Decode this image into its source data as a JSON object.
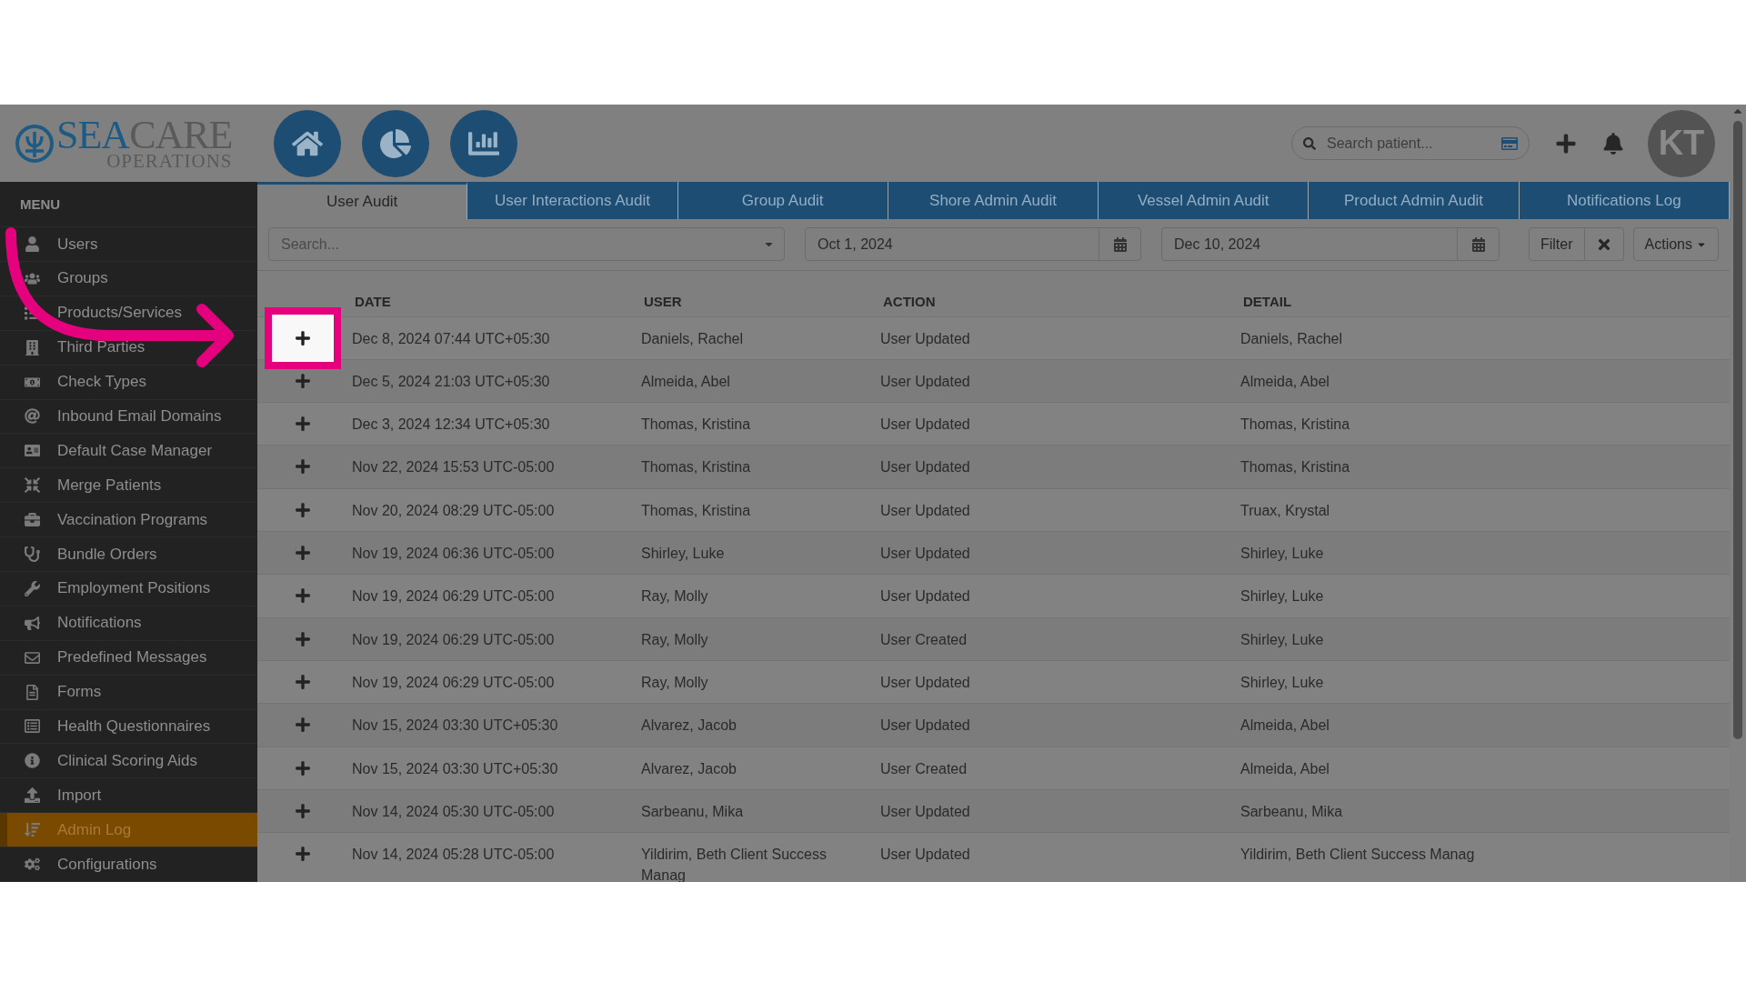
{
  "header": {
    "logo": {
      "brand_a": "SEA",
      "brand_b": "CARE",
      "subtitle": "OPERATIONS"
    },
    "search": {
      "placeholder": "Search patient..."
    },
    "avatar": "KT"
  },
  "sidebar": {
    "title": "MENU",
    "items": [
      {
        "label": "Users",
        "selected": false
      },
      {
        "label": "Groups",
        "selected": false
      },
      {
        "label": "Products/Services",
        "selected": false
      },
      {
        "label": "Third Parties",
        "selected": false
      },
      {
        "label": "Check Types",
        "selected": false
      },
      {
        "label": "Inbound Email Domains",
        "selected": false
      },
      {
        "label": "Default Case Manager",
        "selected": false
      },
      {
        "label": "Merge Patients",
        "selected": false
      },
      {
        "label": "Vaccination Programs",
        "selected": false
      },
      {
        "label": "Bundle Orders",
        "selected": false
      },
      {
        "label": "Employment Positions",
        "selected": false
      },
      {
        "label": "Notifications",
        "selected": false
      },
      {
        "label": "Predefined Messages",
        "selected": false
      },
      {
        "label": "Forms",
        "selected": false
      },
      {
        "label": "Health Questionnaires",
        "selected": false
      },
      {
        "label": "Clinical Scoring Aids",
        "selected": false
      },
      {
        "label": "Import",
        "selected": false
      },
      {
        "label": "Admin Log",
        "selected": true
      },
      {
        "label": "Configurations",
        "selected": false
      }
    ]
  },
  "tabs": [
    {
      "label": "User Audit",
      "selected": true
    },
    {
      "label": "User Interactions Audit",
      "selected": false
    },
    {
      "label": "Group Audit",
      "selected": false
    },
    {
      "label": "Shore Admin Audit",
      "selected": false
    },
    {
      "label": "Vessel Admin Audit",
      "selected": false
    },
    {
      "label": "Product Admin Audit",
      "selected": false
    },
    {
      "label": "Notifications Log",
      "selected": false
    }
  ],
  "filters": {
    "search": {
      "placeholder": "Search..."
    },
    "date_from": "Oct 1, 2024",
    "date_to": "Dec 10, 2024",
    "filter_button": "Filter",
    "actions_button": "Actions"
  },
  "table": {
    "columns": [
      "DATE",
      "USER",
      "ACTION",
      "DETAIL"
    ],
    "rows": [
      {
        "date": "Dec 8, 2024 07:44 UTC+05:30",
        "user": "Daniels, Rachel",
        "action": "User Updated",
        "detail": "Daniels, Rachel",
        "highlighted": true
      },
      {
        "date": "Dec 5, 2024 21:03 UTC+05:30",
        "user": "Almeida, Abel",
        "action": "User Updated",
        "detail": "Almeida, Abel",
        "highlighted": false
      },
      {
        "date": "Dec 3, 2024 12:34 UTC+05:30",
        "user": "Thomas, Kristina",
        "action": "User Updated",
        "detail": "Thomas, Kristina",
        "highlighted": false
      },
      {
        "date": "Nov 22, 2024 15:53 UTC-05:00",
        "user": "Thomas, Kristina",
        "action": "User Updated",
        "detail": "Thomas, Kristina",
        "highlighted": false
      },
      {
        "date": "Nov 20, 2024 08:29 UTC-05:00",
        "user": "Thomas, Kristina",
        "action": "User Updated",
        "detail": "Truax, Krystal",
        "highlighted": false
      },
      {
        "date": "Nov 19, 2024 06:36 UTC-05:00",
        "user": "Shirley, Luke",
        "action": "User Updated",
        "detail": "Shirley, Luke",
        "highlighted": false
      },
      {
        "date": "Nov 19, 2024 06:29 UTC-05:00",
        "user": "Ray, Molly",
        "action": "User Updated",
        "detail": "Shirley, Luke",
        "highlighted": false
      },
      {
        "date": "Nov 19, 2024 06:29 UTC-05:00",
        "user": "Ray, Molly",
        "action": "User Created",
        "detail": "Shirley, Luke",
        "highlighted": false
      },
      {
        "date": "Nov 19, 2024 06:29 UTC-05:00",
        "user": "Ray, Molly",
        "action": "User Updated",
        "detail": "Shirley, Luke",
        "highlighted": false
      },
      {
        "date": "Nov 15, 2024 03:30 UTC+05:30",
        "user": "Alvarez, Jacob",
        "action": "User Updated",
        "detail": "Almeida, Abel",
        "highlighted": false
      },
      {
        "date": "Nov 15, 2024 03:30 UTC+05:30",
        "user": "Alvarez, Jacob",
        "action": "User Created",
        "detail": "Almeida, Abel",
        "highlighted": false
      },
      {
        "date": "Nov 14, 2024 05:30 UTC-05:00",
        "user": "Sarbeanu, Mika",
        "action": "User Updated",
        "detail": "Sarbeanu, Mika",
        "highlighted": false
      },
      {
        "date": "Nov 14, 2024 05:28 UTC-05:00",
        "user": "Yildirim, Beth Client Success Manag",
        "action": "User Updated",
        "detail": "Yildirim, Beth Client Success Manag",
        "highlighted": false
      }
    ]
  }
}
